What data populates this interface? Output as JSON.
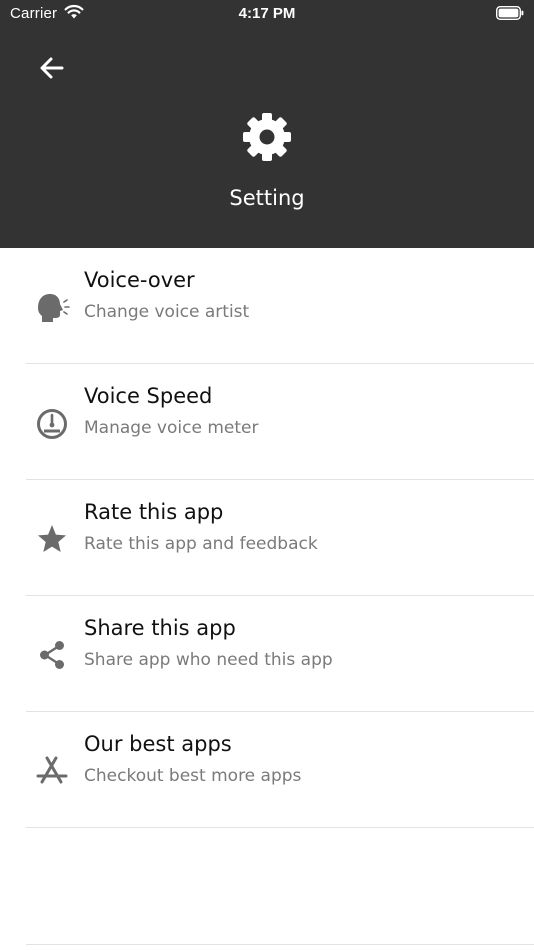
{
  "status_bar": {
    "carrier": "Carrier",
    "time": "4:17 PM"
  },
  "header": {
    "title": "Setting"
  },
  "menu": [
    {
      "title": "Voice-over",
      "subtitle": "Change voice artist",
      "icon": "voice-speaker-icon"
    },
    {
      "title": "Voice Speed",
      "subtitle": "Manage voice meter",
      "icon": "speedometer-icon"
    },
    {
      "title": "Rate this app",
      "subtitle": "Rate this app and feedback",
      "icon": "star-icon"
    },
    {
      "title": "Share this app",
      "subtitle": "Share app who need this app",
      "icon": "share-icon"
    },
    {
      "title": "Our best apps",
      "subtitle": "Checkout best more apps",
      "icon": "app-store-icon"
    }
  ],
  "colors": {
    "header_bg": "#333333",
    "icon_gray": "#6b6b6b",
    "subtitle_gray": "#7a7a7a"
  }
}
